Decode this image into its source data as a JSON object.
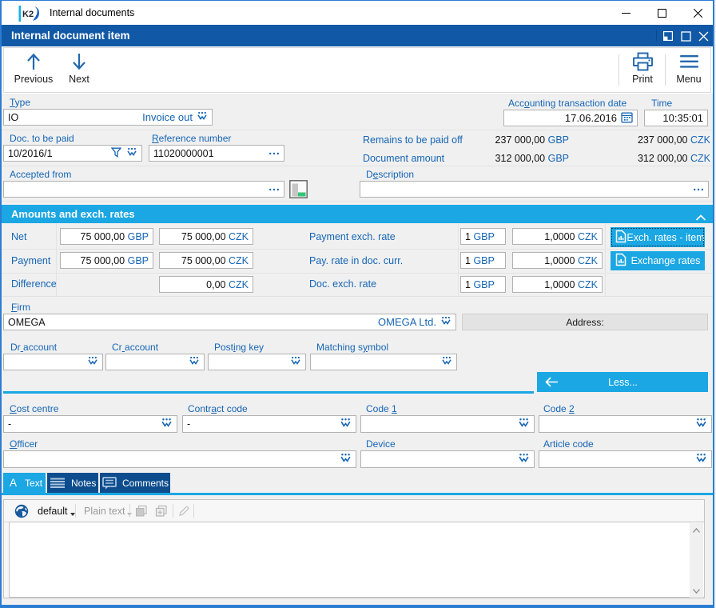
{
  "titlebar": {
    "app_title": "Internal documents",
    "controls": {
      "minimize": "minimize",
      "maximize": "maximize",
      "close": "close"
    }
  },
  "doc_header": {
    "title": "Internal document item",
    "controls": {
      "dock": "dock",
      "maximize": "maximize",
      "close": "close"
    }
  },
  "toolbar": {
    "previous": "Previous",
    "next": "Next",
    "print": "Print",
    "menu": "Menu"
  },
  "head_fields": {
    "type": {
      "label": {
        "text": "Type",
        "u": 0
      },
      "value": "IO",
      "display": "Invoice out"
    },
    "acc_date": {
      "label": {
        "text": "Accounting transaction date",
        "u": 3
      },
      "value": "17.06.2016"
    },
    "time": {
      "label": {
        "text": "Time",
        "u": -1
      },
      "value": "10:35:01"
    },
    "doc_to_be_paid": {
      "label": {
        "text": "Doc. to be paid",
        "u": -1
      },
      "value": "10/2016/1"
    },
    "reference": {
      "label": {
        "text": "Reference number",
        "u": 0
      },
      "value": "11020000001"
    },
    "remains": {
      "label": "Remains to be paid off",
      "gbp": {
        "num": "237 000,00",
        "cur": "GBP"
      },
      "czk": {
        "num": "237 000,00",
        "cur": "CZK"
      }
    },
    "doc_amount": {
      "label": "Document amount",
      "gbp": {
        "num": "312 000,00",
        "cur": "GBP"
      },
      "czk": {
        "num": "312 000,00",
        "cur": "CZK"
      }
    },
    "accepted_from": {
      "label": {
        "text": "Accepted from",
        "u": -1
      },
      "value": ""
    },
    "description": {
      "label": {
        "text": "Description",
        "u": 1
      },
      "value": ""
    }
  },
  "amounts": {
    "header": "Amounts and exch. rates",
    "rows": [
      {
        "label": "Net",
        "gbp": {
          "num": "75 000,00",
          "cur": "GBP"
        },
        "czk": {
          "num": "75 000,00",
          "cur": "CZK"
        }
      },
      {
        "label": "Payment",
        "gbp": {
          "num": "75 000,00",
          "cur": "GBP"
        },
        "czk": {
          "num": "75 000,00",
          "cur": "CZK"
        }
      },
      {
        "label": "Difference",
        "czk": {
          "num": "0,00",
          "cur": "CZK"
        }
      }
    ],
    "rates": [
      {
        "label": "Payment exch. rate",
        "unit": {
          "num": "1",
          "cur": "GBP"
        },
        "rate": {
          "num": "1,0000",
          "cur": "CZK"
        }
      },
      {
        "label": "Pay. rate in doc. curr.",
        "unit": {
          "num": "1",
          "cur": "GBP"
        },
        "rate": {
          "num": "1,0000",
          "cur": "CZK"
        }
      },
      {
        "label": "Doc. exch. rate",
        "unit": {
          "num": "1",
          "cur": "GBP"
        },
        "rate": {
          "num": "1,0000",
          "cur": "CZK"
        }
      }
    ],
    "buttons": [
      {
        "label": "Exch. rates - item"
      },
      {
        "label": "Exchange rates"
      }
    ]
  },
  "firm": {
    "label": {
      "text": "Firm",
      "u": 0
    },
    "code": "OMEGA",
    "display": "OMEGA Ltd.",
    "address_label": "Address:"
  },
  "accounts": {
    "dr": {
      "label": {
        "text": "Dr account",
        "u": 2
      },
      "value": ""
    },
    "cr": {
      "label": {
        "text": "Cr account",
        "u": 2
      },
      "value": ""
    },
    "posting": {
      "label": {
        "text": "Posting key",
        "u": 4
      },
      "value": ""
    },
    "matching": {
      "label": {
        "text": "Matching symbol",
        "u": 10
      },
      "value": ""
    }
  },
  "less_button": {
    "label": "Less..."
  },
  "codes": {
    "cost_centre": {
      "label": {
        "text": "Cost centre",
        "u": 0
      },
      "value": "-"
    },
    "contract_code": {
      "label": {
        "text": "Contract code",
        "u": 5
      },
      "value": "-"
    },
    "code1": {
      "label": {
        "text": "Code 1",
        "u": 5
      },
      "value": ""
    },
    "code2": {
      "label": {
        "text": "Code 2",
        "u": 5
      },
      "value": ""
    },
    "officer": {
      "label": {
        "text": "Officer",
        "u": 0
      },
      "value": ""
    },
    "device": {
      "label": {
        "text": "Device",
        "u": -1
      },
      "value": ""
    },
    "article_code": {
      "label": {
        "text": "Article code",
        "u": -1
      },
      "value": ""
    }
  },
  "tabs": [
    {
      "label": "Text",
      "active": true
    },
    {
      "label": "Notes",
      "active": false
    },
    {
      "label": "Comments",
      "active": false
    }
  ],
  "editor": {
    "language": "default",
    "format": "Plain text",
    "content": ""
  },
  "colors": {
    "accent_cyan": "#1ba7e3",
    "header_blue": "#1159a6",
    "navy_tab": "#0d4d8e",
    "label_blue": "#1565b5",
    "frame_blue": "#2b7cd3",
    "green_indicator": "#35c476"
  }
}
